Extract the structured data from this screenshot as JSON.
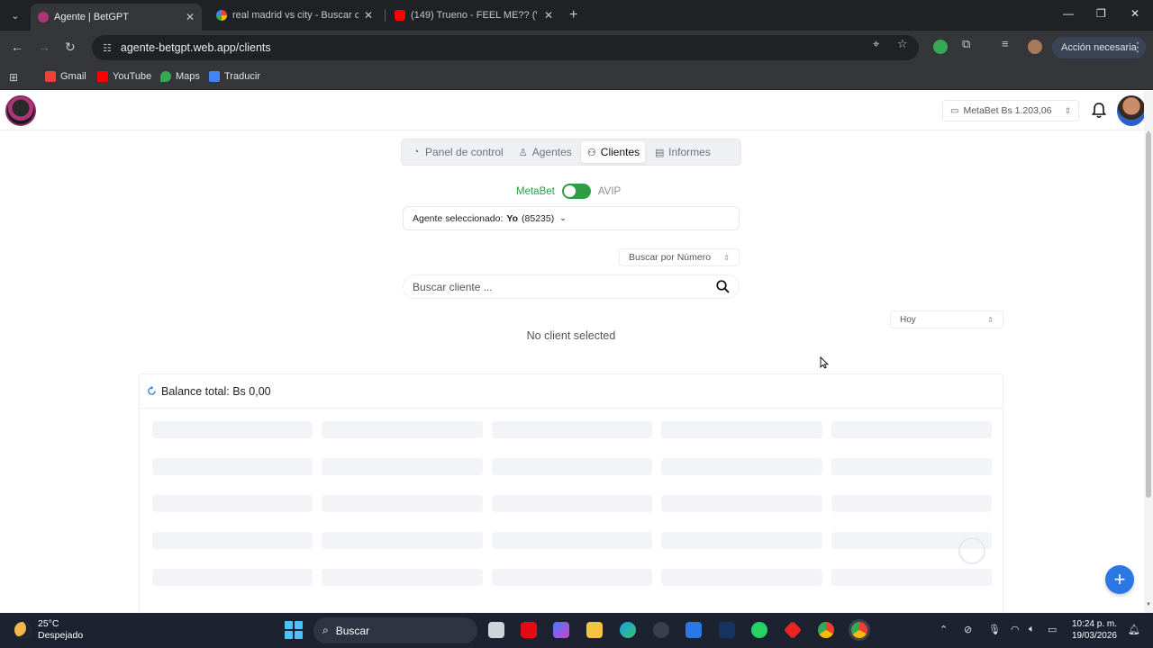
{
  "browser": {
    "tabs": [
      {
        "title": "Agente | BetGPT",
        "active": true
      },
      {
        "title": "real madrid vs city - Buscar con",
        "active": false
      },
      {
        "title": "(149) Trueno - FEEL ME?? (Vide",
        "active": false
      }
    ],
    "url": "agente-betgpt.web.app/clients",
    "profile_button": "Acción necesaria",
    "bookmarks": [
      "Gmail",
      "YouTube",
      "Maps",
      "Traducir"
    ]
  },
  "header": {
    "balance_label": "MetaBet Bs 1.203,06"
  },
  "nav": {
    "items": [
      "Panel de control",
      "Agentes",
      "Clientes",
      "Informes"
    ],
    "active": "Clientes"
  },
  "platform_toggle": {
    "left": "MetaBet",
    "right": "AVIP",
    "selected": "MetaBet"
  },
  "agent_select": {
    "prefix": "Agente seleccionado:",
    "value": "Yo",
    "code": "(85235)"
  },
  "search_type": {
    "value": "Buscar por Número"
  },
  "client_search": {
    "placeholder": "Buscar cliente ..."
  },
  "date_filter": {
    "value": "Hoy"
  },
  "status": {
    "no_client": "No client selected"
  },
  "balance_card": {
    "title": "Balance total: Bs 0,00"
  },
  "taskbar": {
    "weather_temp": "25°C",
    "weather_desc": "Despejado",
    "search_label": "Buscar",
    "time": "10:24 p. m.",
    "date": "19/03/2026"
  },
  "colors": {
    "accent_green": "#2e9d45",
    "fab_blue": "#2b78e4"
  }
}
